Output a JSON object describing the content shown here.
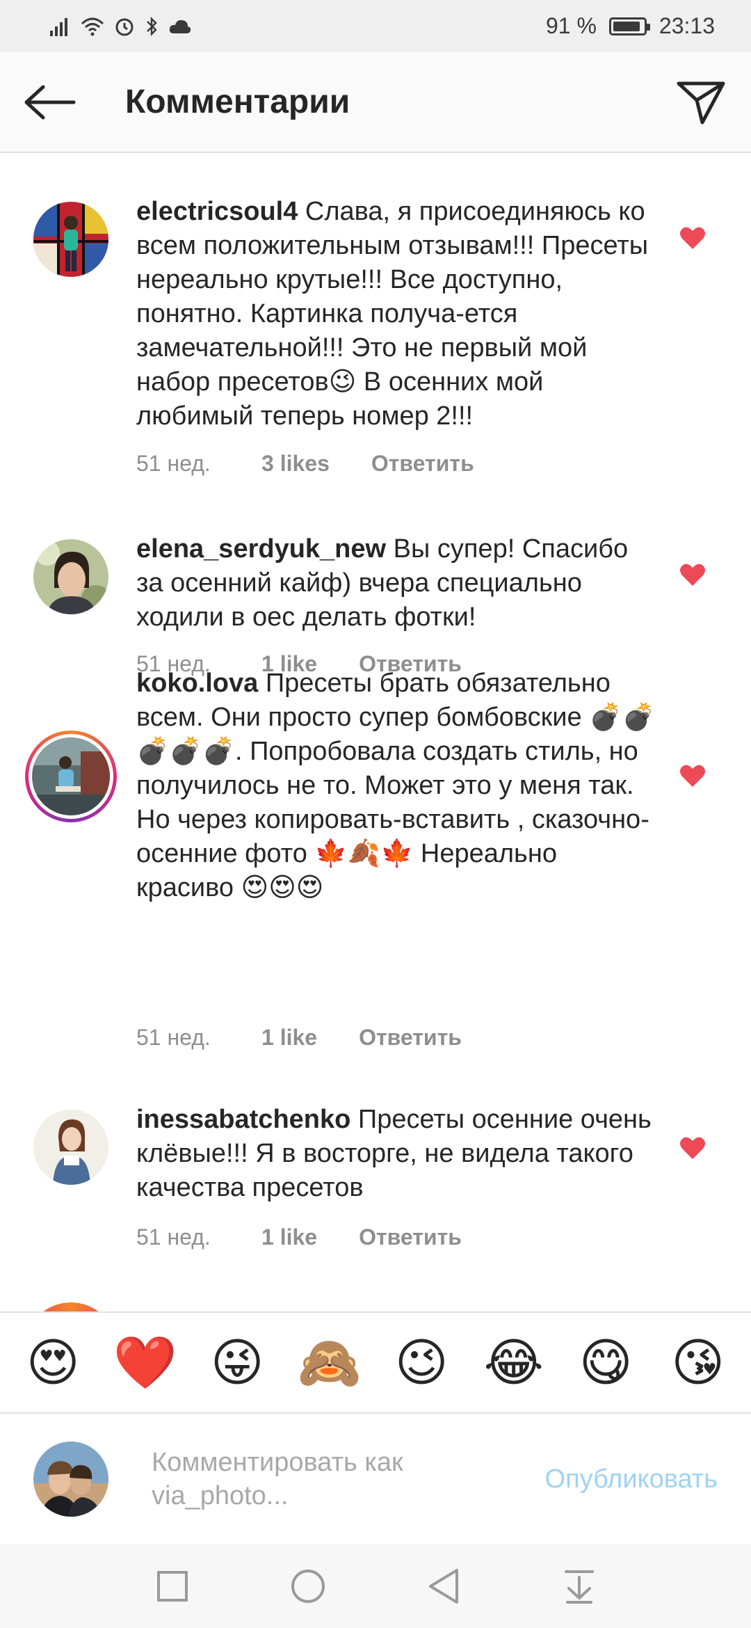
{
  "status_bar": {
    "battery_percent": "91 %",
    "time": "23:13",
    "battery_level": 0.91
  },
  "header": {
    "title": "Комментарии",
    "back_icon": "arrow-left-icon",
    "send_icon": "paper-plane-icon"
  },
  "comments": [
    {
      "username": "electricsoul4",
      "text_a": "Слава, я присоединяюсь ко всем положительным отзывам!!! Пресеты нереально крутые!!! Все доступно, понятно. Картинка получа-ется замечательной!!! Это не первый мой набор пресетов",
      "emoji_a": "😉",
      "text_b": " В осенних мой любимый теперь номер 2!!!",
      "time": "51 нед.",
      "likes": "3 likes",
      "reply": "Ответить",
      "liked": true
    },
    {
      "username": "elena_serdyuk_new",
      "text": "Вы супер! Спасибо за осенний кайф) вчера специально ходили в оес делать фотки!",
      "time": "51 нед.",
      "likes": "1 like",
      "reply": "Ответить",
      "liked": true
    },
    {
      "username": "koko.lova",
      "text_a": "Пресеты брать обязательно всем. Они просто супер бомбовские ",
      "emoji_a": "💣💣💣💣💣",
      "text_b": ". Попробовала создать стиль, но получилось не то. Может это у меня так. Но через копировать-вставить , сказочно-осенние фото ",
      "emoji_b": "🍁🍂🍁",
      "text_c": " Нереально красиво ",
      "emoji_c": "😍😍😍",
      "time": "51 нед.",
      "likes": "1 like",
      "reply": "Ответить",
      "liked": true
    },
    {
      "username": "inessabatchenko",
      "text": "Пресеты осенние очень клёвые!!! Я в восторге, не видела такого качества пресетов",
      "time": "51 нед.",
      "likes": "1 like",
      "reply": "Ответить",
      "liked": true
    }
  ],
  "emoji_bar": [
    "😍",
    "❤️",
    "😜",
    "🙈",
    "😉",
    "😂",
    "😋",
    "😘"
  ],
  "compose": {
    "placeholder": "Комментировать как via_photo...",
    "publish": "Опубликовать"
  },
  "colors": {
    "heart": "#ed4956",
    "publish_disabled": "#9fd2f5",
    "meta": "#8e8e8e"
  }
}
